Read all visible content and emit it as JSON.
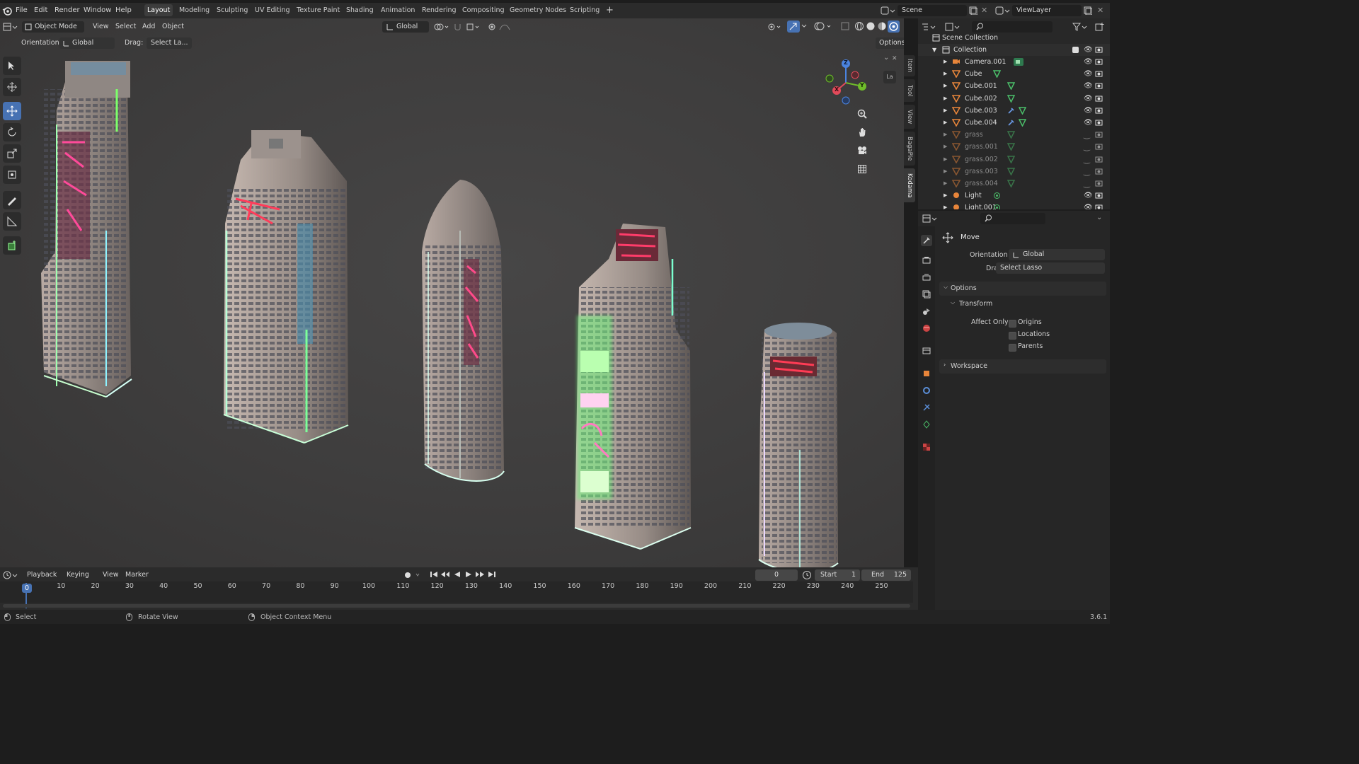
{
  "menubar": {
    "items": [
      "File",
      "Edit",
      "Render",
      "Window",
      "Help"
    ],
    "workspaces": [
      "Layout",
      "Modeling",
      "Sculpting",
      "UV Editing",
      "Texture Paint",
      "Shading",
      "Animation",
      "Rendering",
      "Compositing",
      "Geometry Nodes",
      "Scripting"
    ],
    "active_workspace": "Layout",
    "add_symbol": "+",
    "scene_label": "Scene",
    "view_layer_label": "ViewLayer"
  },
  "viewport_header": {
    "mode": "Object Mode",
    "menus": [
      "View",
      "Select",
      "Add",
      "Object"
    ],
    "transform_orientation": "Global",
    "orientation_label": "Orientation:",
    "orientation_value": "Global",
    "drag_label": "Drag:",
    "drag_value": "Select La...",
    "options_label": "Options"
  },
  "side_tabs": [
    "Item",
    "Tool",
    "View",
    "BagaPie",
    "Kodama"
  ],
  "gizmo": {
    "x": "X",
    "y": "Y",
    "z": "Z"
  },
  "la_label": "La",
  "outliner": {
    "root": "Scene Collection",
    "collection": "Collection",
    "objects": [
      {
        "name": "Camera.001",
        "type": "camera",
        "visible": true
      },
      {
        "name": "Cube",
        "type": "mesh",
        "visible": true
      },
      {
        "name": "Cube.001",
        "type": "mesh",
        "visible": true
      },
      {
        "name": "Cube.002",
        "type": "mesh",
        "visible": true
      },
      {
        "name": "Cube.003",
        "type": "mesh",
        "visible": true
      },
      {
        "name": "Cube.004",
        "type": "mesh",
        "visible": true
      },
      {
        "name": "grass",
        "type": "mesh",
        "visible": false
      },
      {
        "name": "grass.001",
        "type": "mesh",
        "visible": false
      },
      {
        "name": "grass.002",
        "type": "mesh",
        "visible": false
      },
      {
        "name": "grass.003",
        "type": "mesh",
        "visible": false
      },
      {
        "name": "grass.004",
        "type": "mesh",
        "visible": false
      },
      {
        "name": "Light",
        "type": "light",
        "visible": true
      },
      {
        "name": "Light.001",
        "type": "light",
        "visible": true
      }
    ]
  },
  "properties": {
    "tool_name": "Move",
    "orientation_label": "Orientation",
    "orientation_value": "Global",
    "drag_label": "Drag:",
    "drag_value": "Select Lasso",
    "options_label": "Options",
    "transform_label": "Transform",
    "affect_only_label": "Affect Only",
    "affect_only": [
      {
        "label": "Origins",
        "checked": false
      },
      {
        "label": "Locations",
        "checked": false
      },
      {
        "label": "Parents",
        "checked": false
      }
    ],
    "workspace_label": "Workspace"
  },
  "timeline": {
    "menus": [
      "Playback",
      "Keying",
      "View",
      "Marker"
    ],
    "current_frame": "0",
    "start_label": "Start",
    "start_value": "1",
    "end_label": "End",
    "end_value": "125",
    "ticks": [
      "0",
      "10",
      "20",
      "30",
      "40",
      "50",
      "60",
      "70",
      "80",
      "90",
      "100",
      "110",
      "120",
      "130",
      "140",
      "150",
      "160",
      "170",
      "180",
      "190",
      "200",
      "210",
      "220",
      "230",
      "240",
      "250"
    ]
  },
  "statusbar": {
    "select": "Select",
    "rotate": "Rotate View",
    "context": "Object Context Menu",
    "version": "3.6.1"
  },
  "colors": {
    "accent": "#4772b3",
    "mesh": "#e8853a",
    "neon_pink": "#ff3c8c",
    "neon_cyan": "#6ef0ff",
    "neon_green": "#7cff6a"
  }
}
